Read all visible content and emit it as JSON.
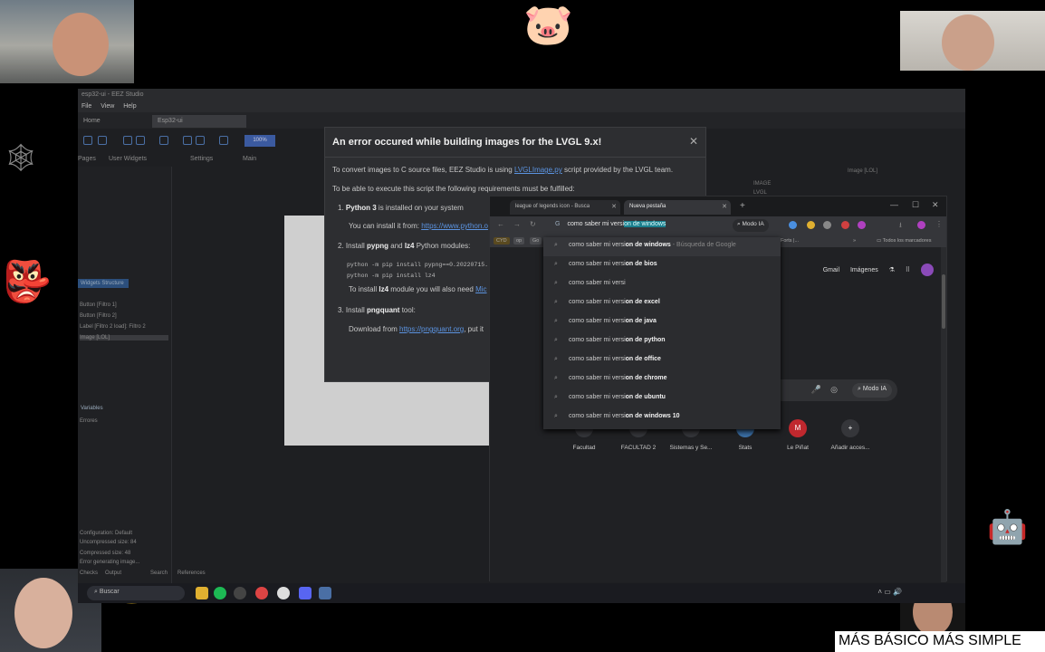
{
  "colors": {
    "dialog_bg": "#2d2e31",
    "browser_bg": "#202124",
    "link": "#5b93e0",
    "selection": "#1a7f8e",
    "caption_bg": "#ffffff"
  },
  "eez": {
    "window_title": "esp32-ui - EEZ Studio",
    "menu": [
      "File",
      "View",
      "Help"
    ],
    "tab_home": "Home",
    "tab_project": "Esp32-ui",
    "toolbar_zoom": "100%",
    "subtabs": [
      "Pages",
      "User Widgets",
      "Settings",
      "Main"
    ],
    "widgets_structure": "Widgets Structure",
    "tree_items": [
      "Button [Filtro 1]",
      "Button [Filtro 2]",
      "Label [Filtro 2 load]: Filtro 2",
      "Image [LOL]"
    ],
    "variables_header": "Variables",
    "variables_item": "Errores",
    "right_items": [
      "Image [LOL]",
      "IMAGE",
      "LVGL"
    ],
    "bottom_lines": [
      "Configuration: Default",
      "Uncompressed size: 84",
      "Compressed size: 48",
      "Error generating image..."
    ],
    "bottom_tabs": [
      "Checks",
      "Output",
      "Search",
      "References"
    ]
  },
  "dialog": {
    "title": "An error occured while building images for the LVGL 9.x!",
    "intro_before": "To convert images to C source files, EEZ Studio is using ",
    "intro_link": "LVGLImage.py",
    "intro_after": " script provided by the LVGL team.",
    "requirements": "To be able to execute this script the following requirements must be fulfilled:",
    "req1_num": "1.",
    "req1_bold": "Python 3",
    "req1_rest": " is installed on your system",
    "req1_sub": "You can install it from: ",
    "req1_link": "https://www.python.o",
    "req2_num": "2.",
    "req2_a": "Install ",
    "req2_b1": "pypng",
    "req2_and": " and ",
    "req2_b2": "lz4",
    "req2_rest": " Python modules:",
    "code1": "python -m pip install pypng==0.20220715.",
    "code2": "python -m pip install lz4",
    "req2_sub_a": "To install ",
    "req2_sub_b": "lz4",
    "req2_sub_c": " module you will also need ",
    "req2_sub_link": "Mic",
    "req3_num": "3.",
    "req3_a": "Install ",
    "req3_b": "pngquant",
    "req3_rest": " tool:",
    "req3_sub": "Download from ",
    "req3_link": "https://pngquant.org",
    "req3_sub_after": ", put it",
    "close_glyph": "✕"
  },
  "browser": {
    "tab1": "league of legends icon - Busca",
    "tab2": "Nueva pestaña",
    "omnibox_prefix": "como saber mi versi",
    "omnibox_selected": "on de windows",
    "modo_ia": "Modo IA",
    "bookmarks": [
      "CYD",
      "op",
      "Go"
    ],
    "bookmarks_right": "Forts |...",
    "all_bookmarks": "Todos los marcadores",
    "gmail": "Gmail",
    "images": "Imágenes",
    "shortcuts": [
      {
        "label": "Facultad",
        "glyph": ""
      },
      {
        "label": "FACULTAD 2",
        "glyph": ""
      },
      {
        "label": "Sistemas y Se...",
        "glyph": ""
      },
      {
        "label": "Stats",
        "glyph": ""
      },
      {
        "label": "Le Piñat",
        "glyph": "M"
      },
      {
        "label": "Añadir acces...",
        "glyph": "+"
      }
    ]
  },
  "suggestions": [
    {
      "prefix": "como saber mi versi",
      "bold": "on de windows",
      "aux": " - Búsqueda de Google"
    },
    {
      "prefix": "como saber mi versi",
      "bold": "on de bios",
      "aux": ""
    },
    {
      "prefix": "como saber mi versi",
      "bold": "",
      "aux": ""
    },
    {
      "prefix": "como saber mi versi",
      "bold": "on de excel",
      "aux": ""
    },
    {
      "prefix": "como saber mi versi",
      "bold": "on de java",
      "aux": ""
    },
    {
      "prefix": "como saber mi versi",
      "bold": "on de python",
      "aux": ""
    },
    {
      "prefix": "como saber mi versi",
      "bold": "on de office",
      "aux": ""
    },
    {
      "prefix": "como saber mi versi",
      "bold": "on de chrome",
      "aux": ""
    },
    {
      "prefix": "como saber mi versi",
      "bold": "on de ubuntu",
      "aux": ""
    },
    {
      "prefix": "como saber mi versi",
      "bold": "on de windows 10",
      "aux": ""
    }
  ],
  "taskbar": {
    "search": "Buscar"
  },
  "caption": "MÁS BÁSICO MÁS SIMPLE"
}
